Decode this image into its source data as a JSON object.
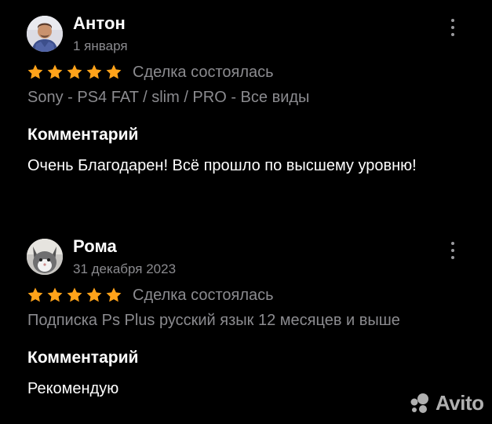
{
  "reviews": [
    {
      "author": "Антон",
      "date": "1 января",
      "rating": 5,
      "deal_status": "Сделка состоялась",
      "item": "Sony - PS4 FAT / slim / PRO - Все виды",
      "comment_title": "Комментарий",
      "comment": "Очень Благодарен! Всё прошло по высшему уровню!"
    },
    {
      "author": "Рома",
      "date": "31 декабря 2023",
      "rating": 5,
      "deal_status": "Сделка состоялась",
      "item": "Подписка Ps Plus русский язык 12 месяцев и выше",
      "comment_title": "Комментарий",
      "comment": "Рекомендую"
    }
  ],
  "icons": {
    "menu": "more-vertical-icon",
    "star": "star-icon"
  },
  "colors": {
    "background": "#000000",
    "star": "#FFA31A",
    "muted_text": "#8b8b8f"
  },
  "watermark": {
    "brand": "Avito"
  }
}
